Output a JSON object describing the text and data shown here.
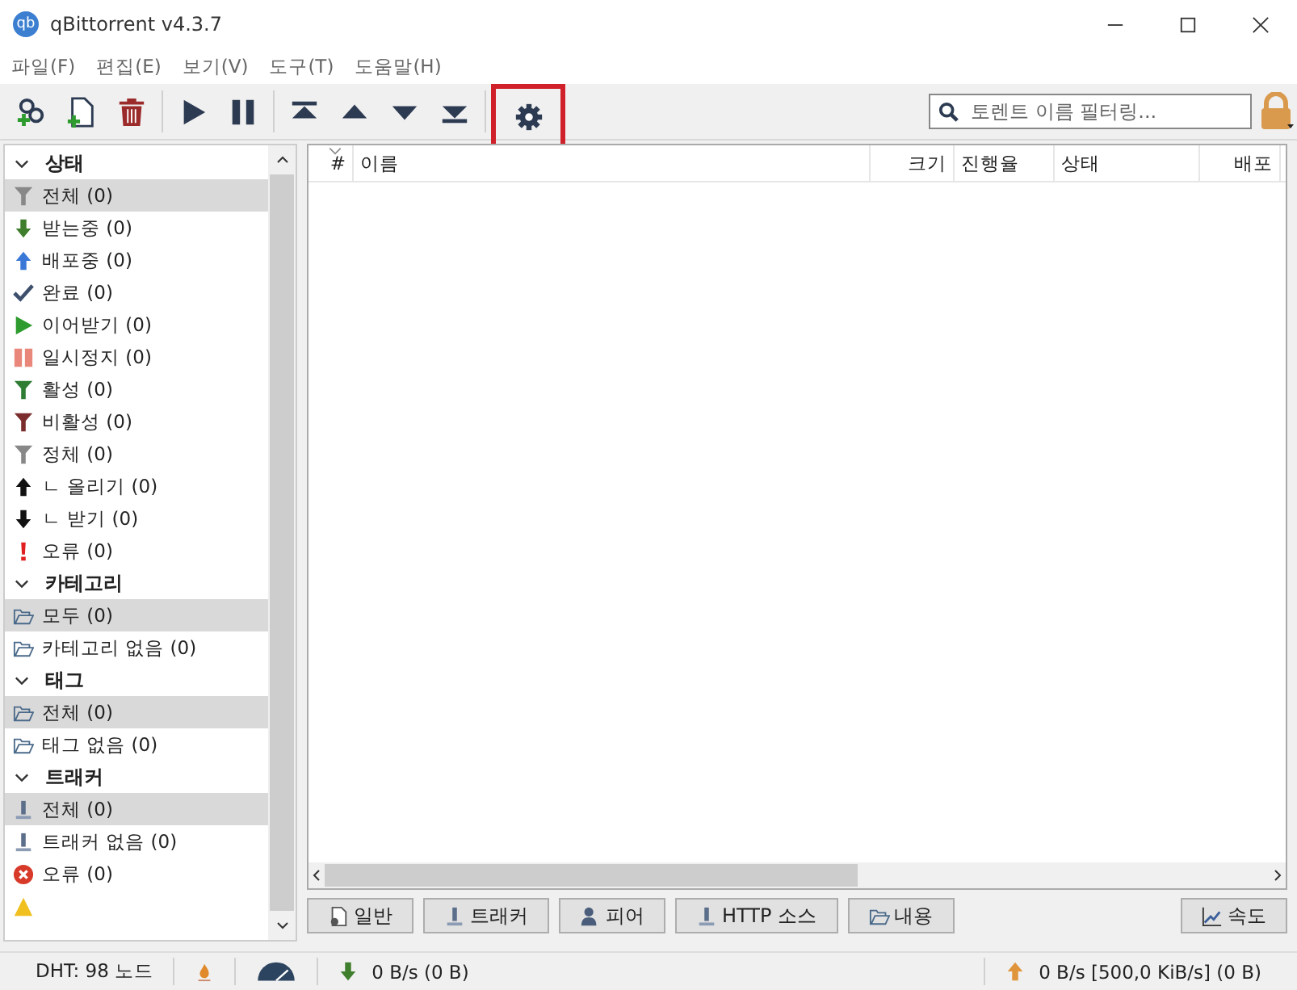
{
  "window": {
    "title": "qBittorrent v4.3.7",
    "logo_text": "qb"
  },
  "menu": [
    "파일(F)",
    "편집(E)",
    "보기(V)",
    "도구(T)",
    "도움말(H)"
  ],
  "toolbar": [
    {
      "kind": "add-link"
    },
    {
      "kind": "add-file"
    },
    {
      "kind": "delete"
    },
    {
      "kind": "sep"
    },
    {
      "kind": "resume"
    },
    {
      "kind": "pause"
    },
    {
      "kind": "sep"
    },
    {
      "kind": "top"
    },
    {
      "kind": "up"
    },
    {
      "kind": "down"
    },
    {
      "kind": "bottom"
    },
    {
      "kind": "sep"
    },
    {
      "kind": "settings",
      "highlighted": true
    }
  ],
  "search": {
    "placeholder": "토렌트 이름 필터링..."
  },
  "sidebar": [
    {
      "title": "상태",
      "expanded": true,
      "items": [
        {
          "kind": "filter-grey",
          "label": "전체 (0)",
          "selected": true
        },
        {
          "kind": "down-green",
          "label": "받는중 (0)",
          "selected": false
        },
        {
          "kind": "up-blue",
          "label": "배포중 (0)",
          "selected": false
        },
        {
          "kind": "check",
          "label": "완료 (0)",
          "selected": false
        },
        {
          "kind": "play",
          "label": "이어받기 (0)",
          "selected": false
        },
        {
          "kind": "pause",
          "label": "일시정지 (0)",
          "selected": false
        },
        {
          "kind": "filter-green",
          "label": "활성 (0)",
          "selected": false
        },
        {
          "kind": "filter-red",
          "label": "비활성 (0)",
          "selected": false
        },
        {
          "kind": "filter-grey",
          "label": "정체 (0)",
          "selected": false
        },
        {
          "kind": "up-black",
          "label": "ㄴ 올리기 (0)",
          "selected": false
        },
        {
          "kind": "down-black",
          "label": "ㄴ 받기 (0)",
          "selected": false
        },
        {
          "kind": "error-mark",
          "label": "오류 (0)",
          "selected": false
        }
      ]
    },
    {
      "title": "카테고리",
      "expanded": true,
      "items": [
        {
          "kind": "folder",
          "label": "모두 (0)",
          "selected": true
        },
        {
          "kind": "folder",
          "label": "카테고리 없음 (0)",
          "selected": false
        }
      ]
    },
    {
      "title": "태그",
      "expanded": true,
      "items": [
        {
          "kind": "folder",
          "label": "전체 (0)",
          "selected": true
        },
        {
          "kind": "folder",
          "label": "태그 없음 (0)",
          "selected": false
        }
      ]
    },
    {
      "title": "트래커",
      "expanded": true,
      "items": [
        {
          "kind": "tracker",
          "label": "전체 (0)",
          "selected": true
        },
        {
          "kind": "tracker",
          "label": "트래커 없음 (0)",
          "selected": false
        },
        {
          "kind": "error-circle",
          "label": "오류 (0)",
          "selected": false
        },
        {
          "kind": "warning",
          "selected": false
        }
      ]
    }
  ],
  "table": {
    "columns": [
      "#",
      "이름",
      "크기",
      "진행율",
      "상태",
      "배포"
    ]
  },
  "detail_tabs": [
    {
      "kind": "general",
      "label": "일반"
    },
    {
      "kind": "tracker",
      "label": "트래커"
    },
    {
      "kind": "peers",
      "label": "피어"
    },
    {
      "kind": "tracker",
      "label": "HTTP 소스"
    },
    {
      "kind": "folder",
      "label": "내용"
    },
    {
      "kind": "chart",
      "label": "속도"
    }
  ],
  "status_bar": {
    "dht": "DHT: 98 노드",
    "download": "0 B/s (0 B)",
    "upload": "0 B/s [500,0 KiB/s] (0 B)"
  }
}
